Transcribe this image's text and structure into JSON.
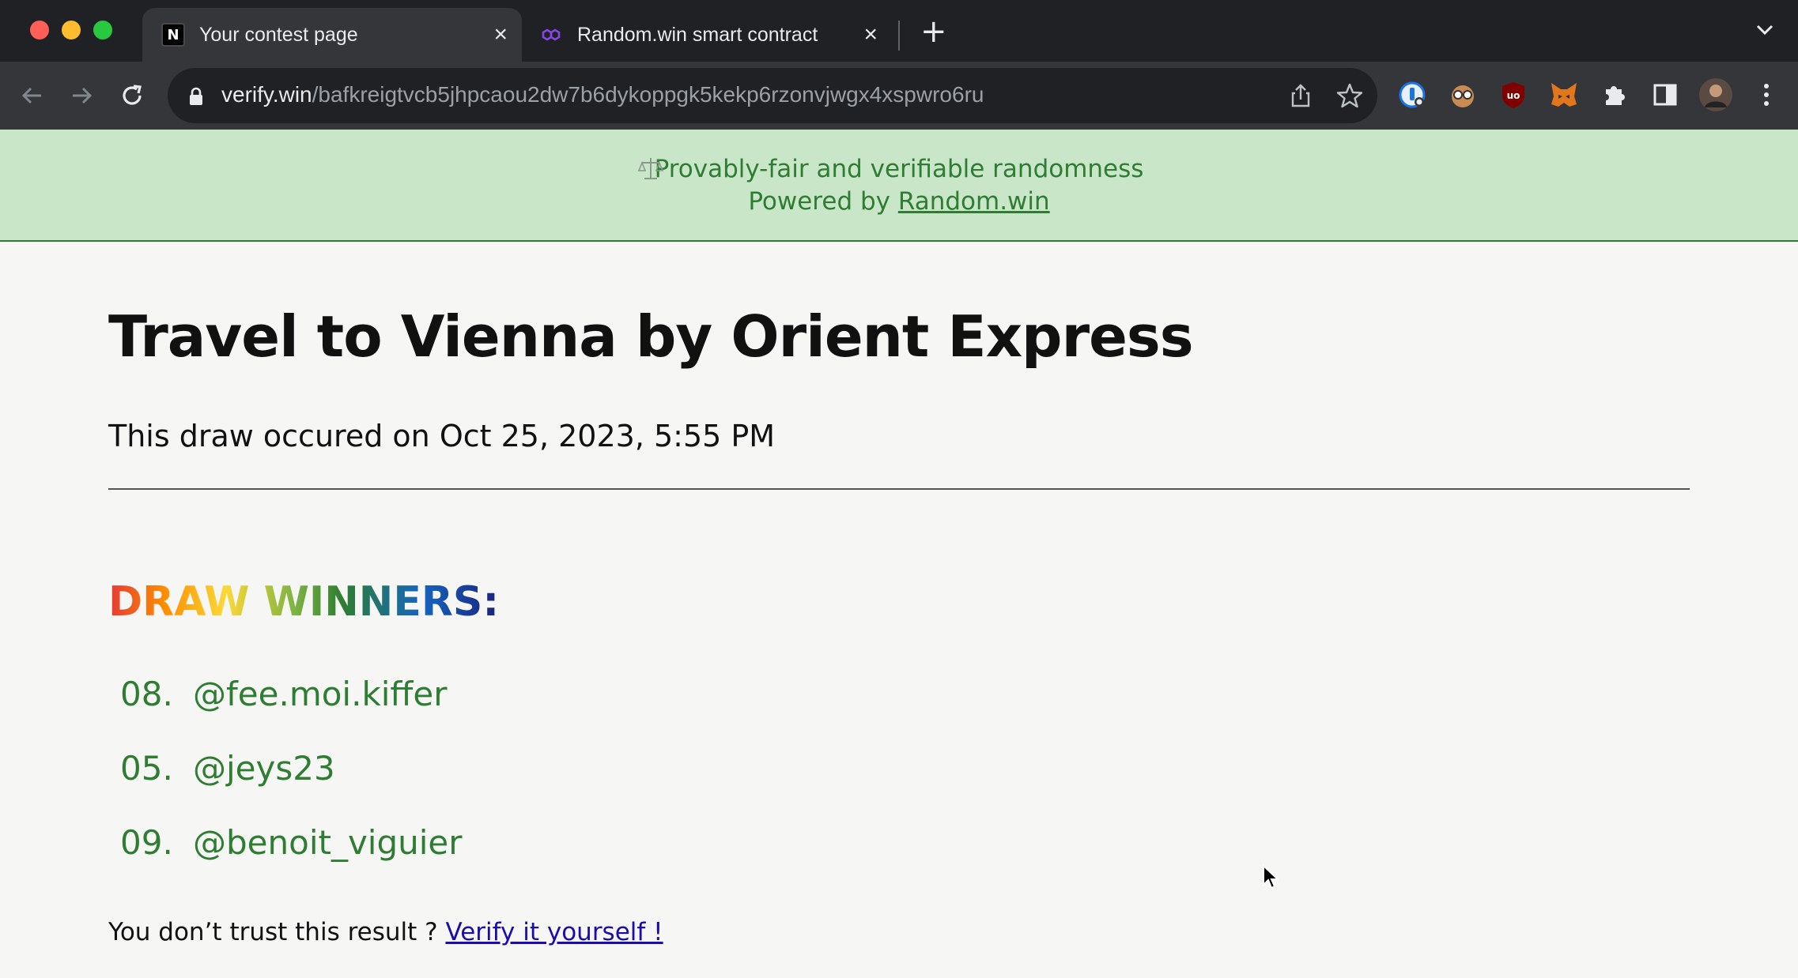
{
  "browser": {
    "tabs": [
      {
        "label": "Your contest page",
        "active": true
      },
      {
        "label": "Random.win smart contract",
        "active": false
      }
    ],
    "close_glyph": "×",
    "new_tab_glyph": "+",
    "url_host": "verify.win",
    "url_path": "/bafkreigtvcb5jhpcaou2dw7b6dykoppgk5kekp6rzonvjwgx4xspwro6ru",
    "extensions": [
      "password-manager-icon",
      "privacy-badger-icon",
      "ublock-icon",
      "metamask-icon",
      "puzzle-extensions-icon",
      "side-panel-icon",
      "profile-avatar",
      "kebab-menu-icon"
    ]
  },
  "banner": {
    "line1": "Provably-fair and verifiable randomness",
    "line2_prefix": "Powered by ",
    "link": "Random.win"
  },
  "contest": {
    "title": "Travel to Vienna by Orient Express",
    "date_line": "This draw occured on Oct 25, 2023, 5:55 PM",
    "winners_heading": "DRAW WINNERS:",
    "winners": [
      {
        "number": "08.",
        "handle": "@fee.moi.kiffer"
      },
      {
        "number": "05.",
        "handle": "@jeys23"
      },
      {
        "number": "09.",
        "handle": "@benoit_viguier"
      }
    ],
    "trust_text": "You don’t trust this result ? ",
    "verify_link": "Verify it yourself !"
  },
  "colors": {
    "banner_bg": "#c9e6c9",
    "accent_green": "#2e7d32",
    "link_blue": "#1a0dab"
  }
}
